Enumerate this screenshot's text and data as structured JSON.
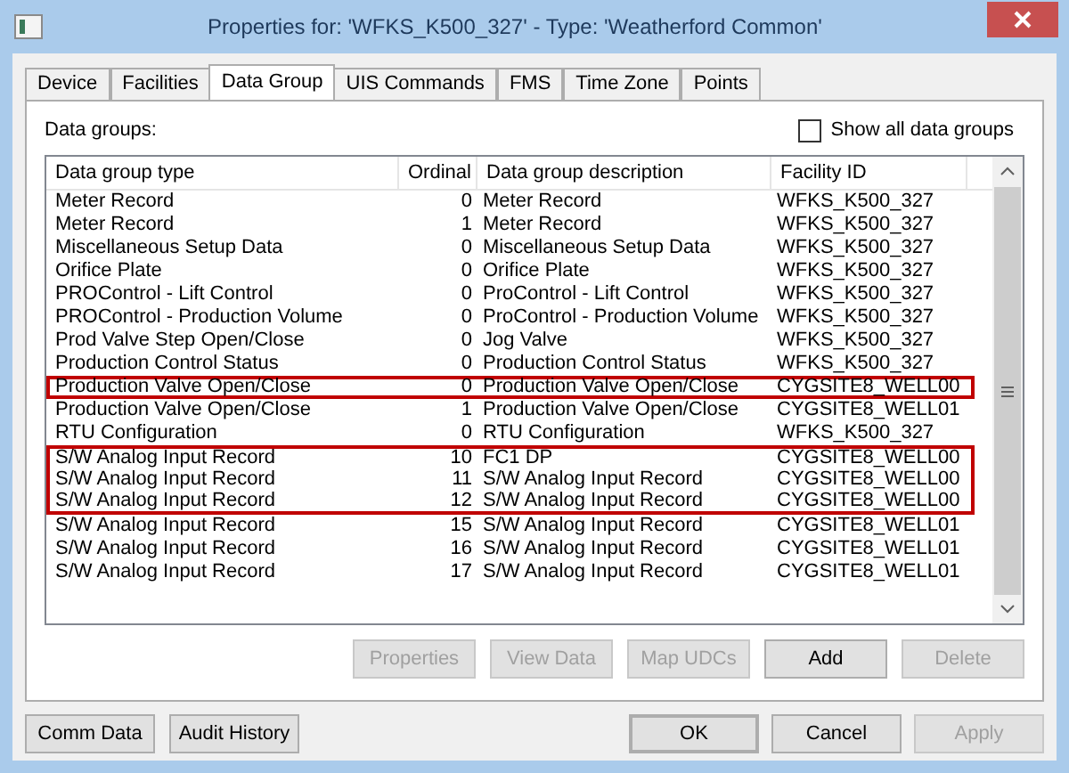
{
  "window": {
    "title": "Properties for: 'WFKS_K500_327' - Type: 'Weatherford Common'"
  },
  "tabs": [
    {
      "label": "Device",
      "selected": false
    },
    {
      "label": "Facilities",
      "selected": false
    },
    {
      "label": "Data Group",
      "selected": true
    },
    {
      "label": "UIS Commands",
      "selected": false
    },
    {
      "label": "FMS",
      "selected": false
    },
    {
      "label": "Time Zone",
      "selected": false
    },
    {
      "label": "Points",
      "selected": false
    }
  ],
  "list_label": "Data groups:",
  "show_all": {
    "label": "Show all data groups",
    "checked": false
  },
  "table": {
    "columns": [
      "Data group type",
      "Ordinal",
      "Data group description",
      "Facility ID"
    ],
    "rows": [
      {
        "cells": [
          "Meter Record",
          "0",
          "Meter Record",
          "WFKS_K500_327"
        ],
        "highlighted": false
      },
      {
        "cells": [
          "Meter Record",
          "1",
          "Meter Record",
          "WFKS_K500_327"
        ],
        "highlighted": false
      },
      {
        "cells": [
          "Miscellaneous Setup Data",
          "0",
          "Miscellaneous Setup Data",
          "WFKS_K500_327"
        ],
        "highlighted": false
      },
      {
        "cells": [
          "Orifice Plate",
          "0",
          "Orifice Plate",
          "WFKS_K500_327"
        ],
        "highlighted": false
      },
      {
        "cells": [
          "PROControl - Lift Control",
          "0",
          "ProControl - Lift Control",
          "WFKS_K500_327"
        ],
        "highlighted": false
      },
      {
        "cells": [
          "PROControl - Production Volume",
          "0",
          "ProControl - Production Volume",
          "WFKS_K500_327"
        ],
        "highlighted": false
      },
      {
        "cells": [
          "Prod Valve Step Open/Close",
          "0",
          "Jog Valve",
          "WFKS_K500_327"
        ],
        "highlighted": false
      },
      {
        "cells": [
          "Production Control Status",
          "0",
          "Production Control Status",
          "WFKS_K500_327"
        ],
        "highlighted": false
      },
      {
        "cells": [
          "Production Valve Open/Close",
          "0",
          "Production Valve Open/Close",
          "CYGSITE8_WELL00"
        ],
        "highlighted": true
      },
      {
        "cells": [
          "Production Valve Open/Close",
          "1",
          "Production Valve Open/Close",
          "CYGSITE8_WELL01"
        ],
        "highlighted": false
      },
      {
        "cells": [
          "RTU Configuration",
          "0",
          "RTU Configuration",
          "WFKS_K500_327"
        ],
        "highlighted": false
      },
      {
        "cells": [
          "S/W Analog Input Record",
          "10",
          "FC1 DP",
          "CYGSITE8_WELL00"
        ],
        "highlighted": true
      },
      {
        "cells": [
          "S/W Analog Input Record",
          "11",
          "S/W Analog Input Record",
          "CYGSITE8_WELL00"
        ],
        "highlighted": true
      },
      {
        "cells": [
          "S/W Analog Input Record",
          "12",
          "S/W Analog Input Record",
          "CYGSITE8_WELL00"
        ],
        "highlighted": true
      },
      {
        "cells": [
          "S/W Analog Input Record",
          "15",
          "S/W Analog Input Record",
          "CYGSITE8_WELL01"
        ],
        "highlighted": false
      },
      {
        "cells": [
          "S/W Analog Input Record",
          "16",
          "S/W Analog Input Record",
          "CYGSITE8_WELL01"
        ],
        "highlighted": false
      },
      {
        "cells": [
          "S/W Analog Input Record",
          "17",
          "S/W Analog Input Record",
          "CYGSITE8_WELL01"
        ],
        "highlighted": false
      }
    ]
  },
  "list_buttons": [
    {
      "label": "Properties",
      "disabled": true
    },
    {
      "label": "View Data",
      "disabled": true
    },
    {
      "label": "Map UDCs",
      "disabled": true
    },
    {
      "label": "Add",
      "disabled": false
    },
    {
      "label": "Delete",
      "disabled": true
    }
  ],
  "left_buttons": [
    {
      "label": "Comm Data",
      "disabled": false
    },
    {
      "label": "Audit History",
      "disabled": false
    }
  ],
  "right_buttons": [
    {
      "label": "OK",
      "disabled": false,
      "default": true
    },
    {
      "label": "Cancel",
      "disabled": false,
      "default": false
    },
    {
      "label": "Apply",
      "disabled": true,
      "default": false
    }
  ]
}
